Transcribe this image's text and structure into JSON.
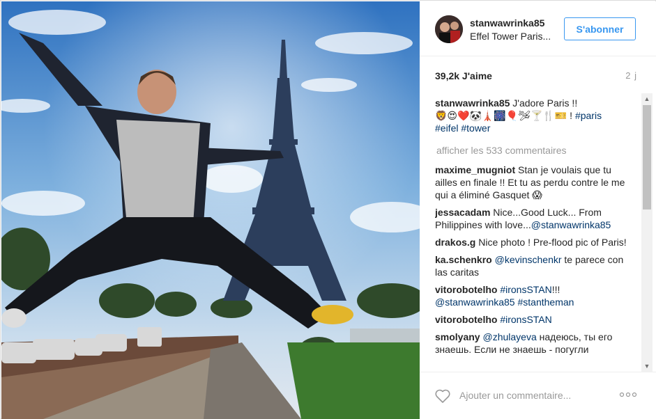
{
  "post": {
    "username": "stanwawrinka85",
    "location": "Effel Tower Paris...",
    "follow_label": "S'abonner",
    "likes": "39,2k J'aime",
    "time_ago": "2 j"
  },
  "caption": {
    "user": "stanwawrinka85",
    "text": "J'adore Paris !!",
    "emoji_line": "🦁😍❤️🐼🗼🎆🎈🛩🍸🍴🎫 !",
    "tags": [
      "#paris",
      "#eifel",
      "#tower"
    ]
  },
  "more_comments_label": "afficher les 533 commentaires",
  "comments": [
    {
      "user": "maxime_mugniot",
      "text": "Stan je voulais que tu ailles en finale !! Et tu as perdu contre le me qui a éliminé Gasquet 😱"
    },
    {
      "user": "jessacadam",
      "text": "Nice...Good Luck... From Philippines with love...",
      "mention": "@stanwawrinka85"
    },
    {
      "user": "drakos.g",
      "text": "Nice photo ! Pre-flood pic of Paris!"
    },
    {
      "user": "ka.schenkro",
      "mention": "@kevinschenkr",
      "text": "te parece con las caritas"
    },
    {
      "user": "vitorobotelho",
      "tag": "#ironsSTAN",
      "text": "!!!",
      "mention": "@stanwawrinka85",
      "tag2": "#stantheman"
    },
    {
      "user": "vitorobotelho",
      "tag": "#ironsSTAN"
    },
    {
      "user": "smolyany",
      "mention": "@zhulayeva",
      "text": "надеюсь, ты его знаешь. Если не знаешь - погугли"
    }
  ],
  "footer": {
    "add_comment_placeholder": "Ajouter un commentaire...",
    "heart_icon": "heart-outline-icon",
    "options_icon": "more-options-icon"
  },
  "colors": {
    "link_blue": "#3897f0",
    "tag_blue": "#003569",
    "muted": "#999999"
  }
}
